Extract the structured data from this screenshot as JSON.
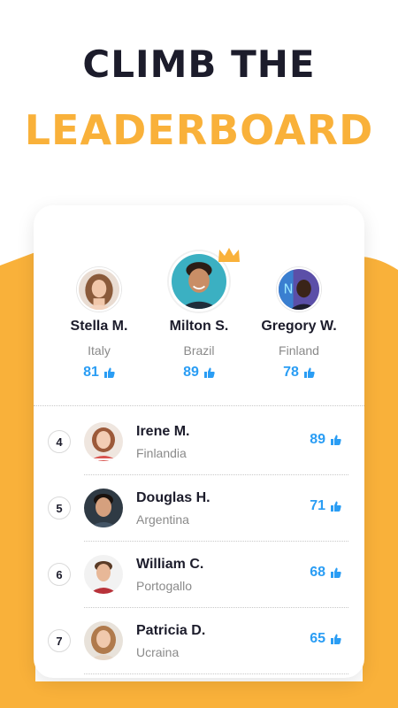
{
  "headline": {
    "line1": "CLIMB THE",
    "line2": "LEADERBOARD"
  },
  "colors": {
    "accent_orange": "#f9b13a",
    "title_dark": "#1c1c2b",
    "score_blue": "#2a9df4"
  },
  "podium": [
    {
      "name": "Stella M.",
      "country": "Italy",
      "score": "81",
      "icon": "thumbs-up-icon"
    },
    {
      "name": "Milton S.",
      "country": "Brazil",
      "score": "89",
      "icon": "thumbs-up-icon",
      "badge": "crown-icon"
    },
    {
      "name": "Gregory W.",
      "country": "Finland",
      "score": "78",
      "icon": "thumbs-up-icon"
    }
  ],
  "leaderboard": [
    {
      "rank": "4",
      "name": "Irene M.",
      "country": "Finlandia",
      "score": "89"
    },
    {
      "rank": "5",
      "name": "Douglas H.",
      "country": "Argentina",
      "score": "71"
    },
    {
      "rank": "6",
      "name": "William C.",
      "country": "Portogallo",
      "score": "68"
    },
    {
      "rank": "7",
      "name": "Patricia D.",
      "country": "Ucraina",
      "score": "65"
    }
  ]
}
